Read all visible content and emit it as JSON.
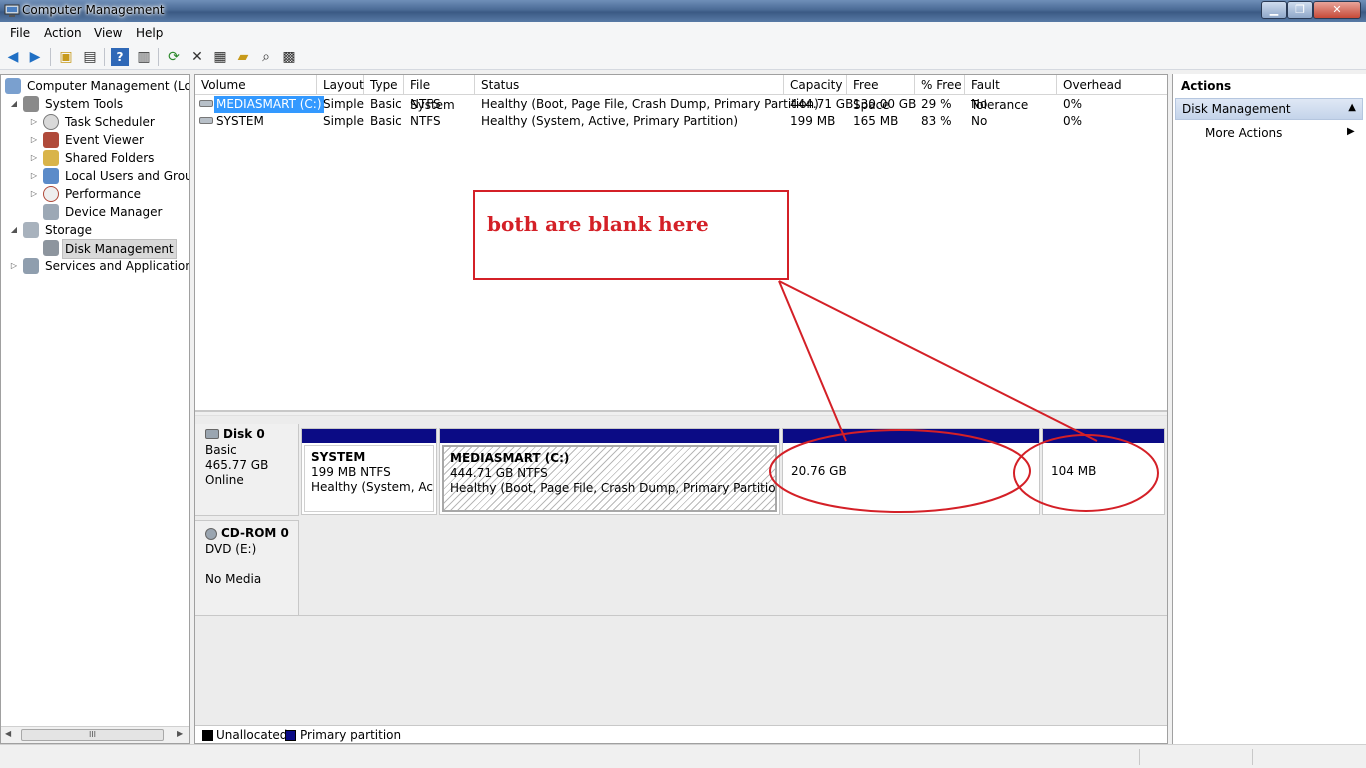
{
  "window": {
    "title": "Computer Management"
  },
  "menu": [
    "File",
    "Action",
    "View",
    "Help"
  ],
  "tree": {
    "root": "Computer Management (Local",
    "system_tools": "System Tools",
    "task_scheduler": "Task Scheduler",
    "event_viewer": "Event Viewer",
    "shared_folders": "Shared Folders",
    "local_users": "Local Users and Groups",
    "performance": "Performance",
    "device_manager": "Device Manager",
    "storage": "Storage",
    "disk_management": "Disk Management",
    "services": "Services and Applications",
    "scroll_grip": "III"
  },
  "volumes": {
    "columns": [
      "Volume",
      "Layout",
      "Type",
      "File System",
      "Status",
      "Capacity",
      "Free Space",
      "% Free",
      "Fault Tolerance",
      "Overhead"
    ],
    "rows": [
      {
        "volume": "MEDIASMART (C:)",
        "layout": "Simple",
        "type": "Basic",
        "fs": "NTFS",
        "status": "Healthy (Boot, Page File, Crash Dump, Primary Partition)",
        "capacity": "444.71 GB",
        "free": "130.00 GB",
        "pct": "29 %",
        "fault": "No",
        "overhead": "0%"
      },
      {
        "volume": "SYSTEM",
        "layout": "Simple",
        "type": "Basic",
        "fs": "NTFS",
        "status": "Healthy (System, Active, Primary Partition)",
        "capacity": "199 MB",
        "free": "165 MB",
        "pct": "83 %",
        "fault": "No",
        "overhead": "0%"
      }
    ]
  },
  "disks": {
    "disk0": {
      "name": "Disk 0",
      "type": "Basic",
      "size": "465.77 GB",
      "status": "Online"
    },
    "system_part": {
      "name": "SYSTEM",
      "size": "199 MB NTFS",
      "status": "Healthy (System, Active"
    },
    "c_part": {
      "name": "MEDIASMART  (C:)",
      "size": "444.71 GB NTFS",
      "status": "Healthy (Boot, Page File, Crash Dump, Primary Partition)"
    },
    "blank1": {
      "size": "20.76 GB"
    },
    "blank2": {
      "size": "104 MB"
    },
    "cdrom": {
      "name": "CD-ROM 0",
      "drive": "DVD (E:)",
      "status": "No Media"
    }
  },
  "legend": {
    "unallocated": "Unallocated",
    "primary": "Primary partition"
  },
  "annotation": {
    "text": "both are blank here",
    "color": "#d42027"
  },
  "actions": {
    "title": "Actions",
    "section": "Disk Management",
    "more": "More Actions"
  },
  "colors": {
    "partition_bar": "#0b0b85",
    "selection": "#3399ff"
  }
}
